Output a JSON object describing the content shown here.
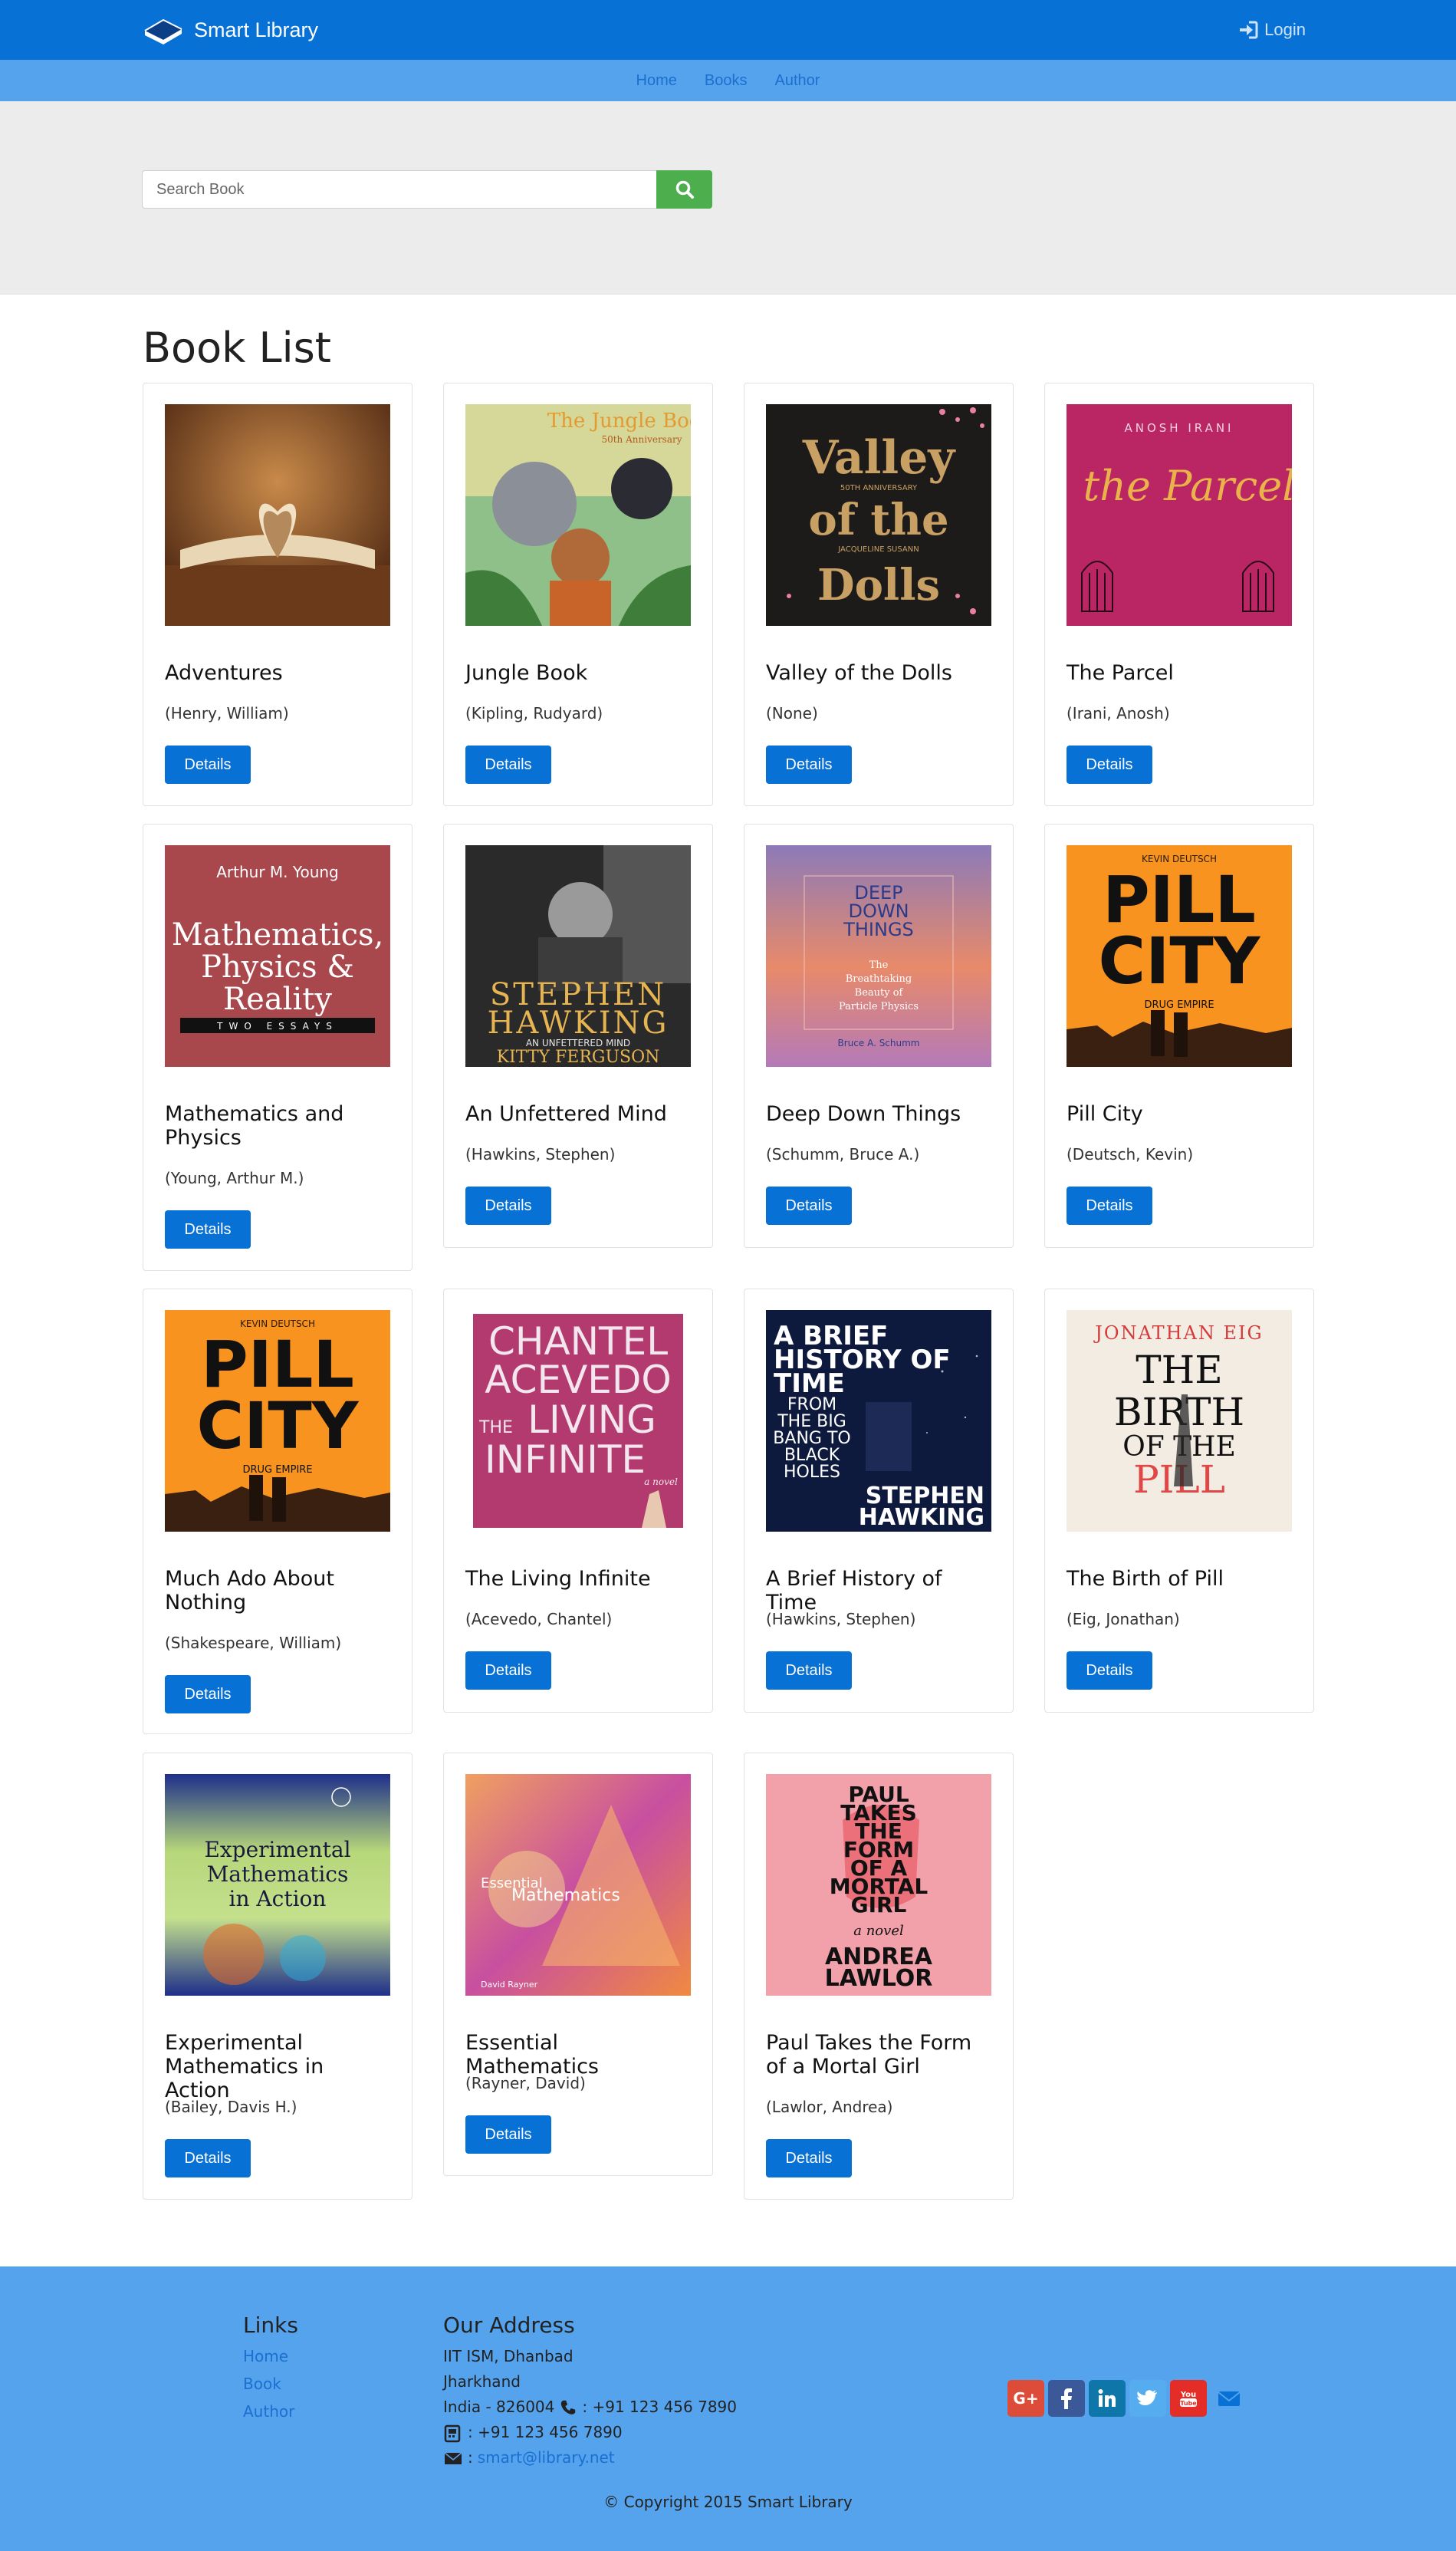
{
  "app": {
    "brand": "Smart Library",
    "login_label": "Login"
  },
  "subnav": {
    "items": [
      {
        "label": "Home"
      },
      {
        "label": "Books"
      },
      {
        "label": "Author"
      }
    ]
  },
  "search": {
    "placeholder": "Search Book",
    "value": ""
  },
  "book_list": {
    "heading": "Book List",
    "details_label": "Details",
    "books": [
      {
        "title": "Adventures",
        "author": "(Henry, William)",
        "cover": "open-book-heart-image"
      },
      {
        "title": "Jungle Book",
        "author": "(Kipling, Rudyard)",
        "cover": "jungle-book-cover",
        "cover_text": [
          "The Jungle Book",
          "50th Anniversary"
        ]
      },
      {
        "title": "Valley of the Dolls",
        "author": "(None)",
        "cover": "valley-of-the-dolls-cover",
        "cover_text": [
          "Valley",
          "of the",
          "Dolls",
          "50TH ANNIVERSARY",
          "JACQUELINE SUSANN"
        ]
      },
      {
        "title": "The Parcel",
        "author": "(Irani, Anosh)",
        "cover": "the-parcel-cover",
        "cover_text": [
          "ANOSH IRANI",
          "the Parcel"
        ]
      },
      {
        "title": "Mathematics and Physics",
        "author": "(Young, Arthur M.)",
        "cover": "mathematics-physics-reality-cover",
        "cover_text": [
          "Arthur M. Young",
          "Mathematics,",
          "Physics &",
          "Reality",
          "TWO ESSAYS"
        ]
      },
      {
        "title": "An Unfettered Mind",
        "author": "(Hawkins, Stephen)",
        "cover": "stephen-hawking-cover",
        "cover_text": [
          "STEPHEN",
          "HAWKING",
          "AN UNFETTERED MIND",
          "KITTY FERGUSON"
        ]
      },
      {
        "title": "Deep Down Things",
        "author": "(Schumm, Bruce A.)",
        "cover": "deep-down-things-cover",
        "cover_text": [
          "DEEP",
          "DOWN",
          "THINGS",
          "The",
          "Breathtaking",
          "Beauty of",
          "Particle Physics",
          "Bruce A. Schumm"
        ]
      },
      {
        "title": "Pill City",
        "author": "(Deutsch, Kevin)",
        "cover": "pill-city-cover",
        "cover_text": [
          "KEVIN DEUTSCH",
          "PILL",
          "CITY",
          "DRUG EMPIRE"
        ]
      },
      {
        "title": "Much Ado About Nothing",
        "author": "(Shakespeare, William)",
        "cover": "pill-city-cover",
        "cover_text": [
          "KEVIN DEUTSCH",
          "PILL",
          "CITY",
          "DRUG EMPIRE"
        ]
      },
      {
        "title": "The Living Infinite",
        "author": "(Acevedo, Chantel)",
        "cover": "the-living-infinite-cover",
        "cover_text": [
          "CHANTEL",
          "ACEVEDO",
          "THE",
          "LIVING",
          "INFINITE",
          "a novel"
        ]
      },
      {
        "title": "A Brief History of Time",
        "author": "(Hawkins, Stephen)",
        "cover": "brief-history-of-time-cover",
        "cover_text": [
          "A BRIEF",
          "HISTORY OF",
          "TIME",
          "FROM",
          "THE BIG",
          "BANG TO",
          "BLACK",
          "HOLES",
          "STEPHEN",
          "HAWKING"
        ]
      },
      {
        "title": "The Birth of Pill",
        "author": "(Eig, Jonathan)",
        "cover": "birth-of-the-pill-cover",
        "cover_text": [
          "JONATHAN EIG",
          "THE",
          "BIRTH",
          "OF THE",
          "PILL"
        ]
      },
      {
        "title": "Experimental Mathematics in Action",
        "author": "(Bailey, Davis H.)",
        "cover": "experimental-mathematics-cover",
        "cover_text": [
          "Experimental",
          "Mathematics",
          "in Action"
        ]
      },
      {
        "title": "Essential Mathematics",
        "author": "(Rayner, David)",
        "cover": "essential-mathematics-cover",
        "cover_text": [
          "Essential",
          "Mathematics",
          "David Rayner"
        ]
      },
      {
        "title": "Paul Takes the Form of a Mortal Girl",
        "author": "(Lawlor, Andrea)",
        "cover": "paul-takes-the-form-cover",
        "cover_text": [
          "PAUL",
          "TAKES",
          "THE",
          "FORM",
          "OF A",
          "MORTAL",
          "GIRL",
          "a novel",
          "ANDREA",
          "LAWLOR"
        ]
      }
    ]
  },
  "footer": {
    "links_heading": "Links",
    "links": [
      {
        "label": "Home"
      },
      {
        "label": "Book"
      },
      {
        "label": "Author"
      }
    ],
    "address_heading": "Our Address",
    "address_lines": [
      "IIT ISM, Dhanbad",
      "Jharkhand",
      "India - 826004"
    ],
    "phone": ": +91 123 456 7890",
    "fax": ": +91 123 456 7890",
    "email_prefix": ": ",
    "email": "smart@library.net",
    "social": [
      "google-plus",
      "facebook",
      "linkedin",
      "twitter",
      "youtube",
      "email"
    ],
    "copyright": "© Copyright 2015 Smart Library"
  },
  "colors": {
    "primary": "#0771d6",
    "subnav": "#55a3ed",
    "search_button": "#4cae4c",
    "hero_bg": "#ececec"
  }
}
